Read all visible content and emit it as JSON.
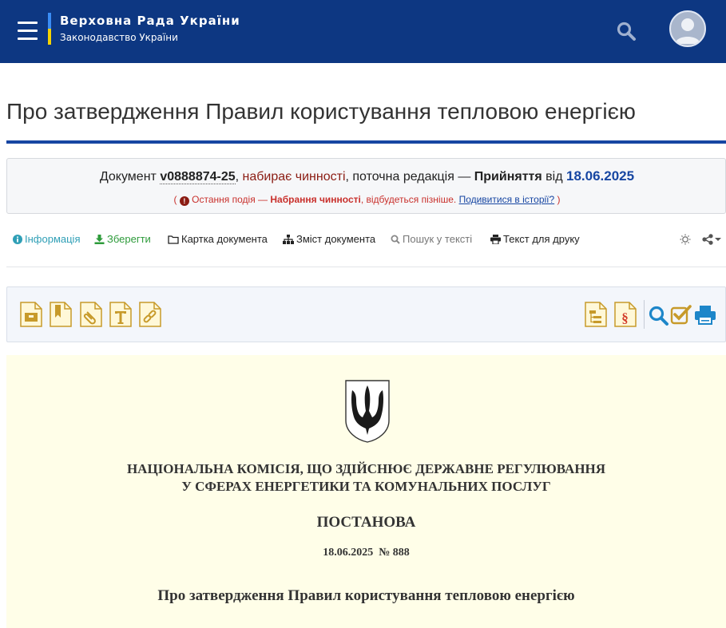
{
  "header": {
    "brand_title": "Верховна Рада України",
    "brand_subtitle": "Законодавство України",
    "icons": [
      "menu-icon",
      "search-icon",
      "user-avatar-icon"
    ]
  },
  "page": {
    "title": "Про затвердження Правил користування тепловою енергією"
  },
  "status": {
    "doc_prefix": "Документ",
    "doc_number": "v0888874-25",
    "comma1": ", ",
    "state": "набирає чинності",
    "mid": ", поточна редакція — ",
    "edition": "Прийняття",
    "from": " від ",
    "date": "18.06.2025",
    "note_open": "( ",
    "note_text": " Остання подія — ",
    "note_event": "Набрання чинності",
    "note_rest": ", відбудеться пізніше. ",
    "note_link": "Подивитися в історії?",
    "note_close": " )"
  },
  "tabs": {
    "info": "Інформація",
    "save": "Зберегти",
    "card": "Картка документа",
    "toc": "Зміст документа",
    "search": "Пошук у тексті",
    "print": "Текст для друку"
  },
  "document": {
    "org_line1": "НАЦІОНАЛЬНА КОМІСІЯ, ЩО ЗДІЙСНЮЄ ДЕРЖАВНЕ РЕГУЛЮВАННЯ",
    "org_line2": "У СФЕРАХ ЕНЕРГЕТИКИ ТА КОМУНАЛЬНИХ ПОСЛУГ",
    "type": "ПОСТАНОВА",
    "date_number": "18.06.2025  № 888",
    "title": "Про затвердження Правил користування тепловою енергією"
  },
  "colors": {
    "header_bg": "#0d3782",
    "accent_blue": "#1746a2",
    "state_red": "#8b1c13",
    "note_red": "#c9302c",
    "info_teal": "#2f9fb6",
    "save_green": "#2e9b3b",
    "tool_gold": "#c79a2a",
    "doc_bg": "#fffee8"
  }
}
